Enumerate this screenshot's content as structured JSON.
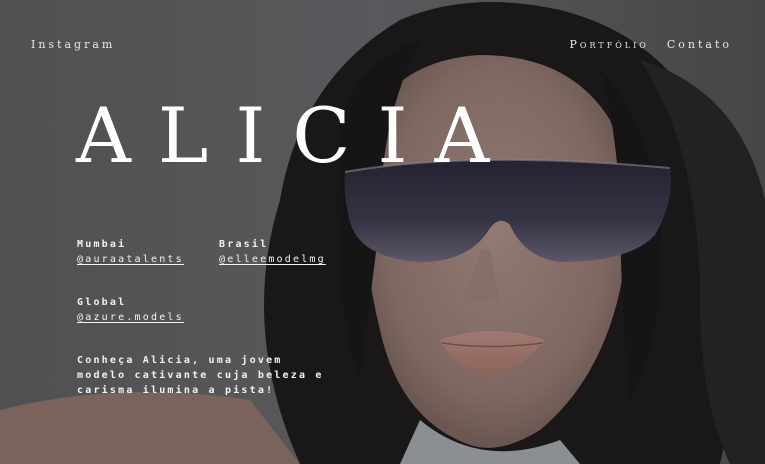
{
  "nav": {
    "instagram": "Instagram",
    "portfolio": "Portfólio",
    "contact": "Contato"
  },
  "title": "ALICIA",
  "agencies": [
    {
      "city": "Mumbai",
      "handle": "@auraatalents"
    },
    {
      "city": "Brasil",
      "handle": "@elleemodelmg"
    },
    {
      "city": "Global",
      "handle": "@azure.models"
    }
  ],
  "description": "Conheça Alicia, uma jovem modelo cativante cuja beleza e carisma ilumina a pista!",
  "colors": {
    "text": "#ffffff",
    "overlay": "#555557"
  }
}
